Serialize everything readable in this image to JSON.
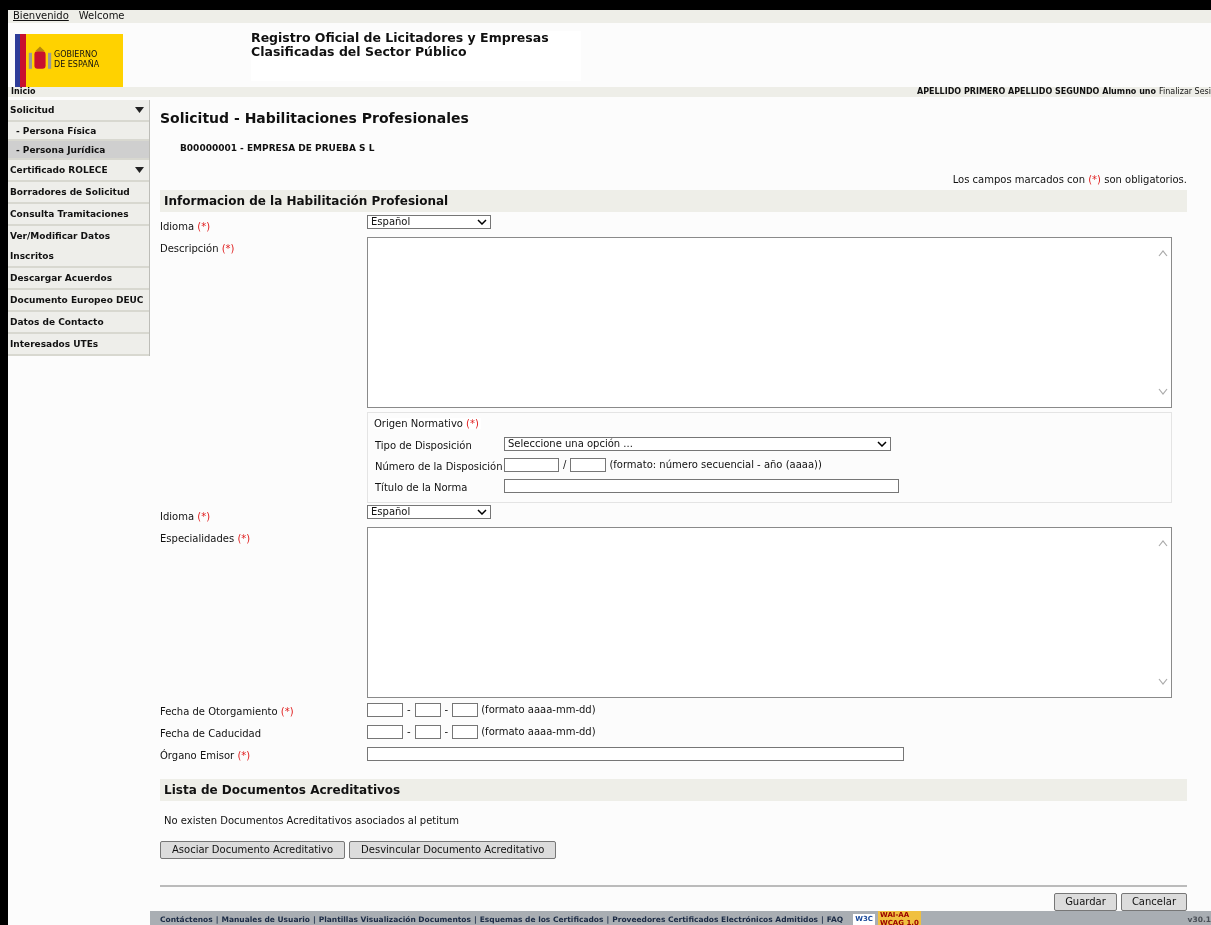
{
  "top_bar": [
    {
      "text": "Bienvenido",
      "kind": "link"
    },
    {
      "text": "Welcome",
      "kind": "plain"
    }
  ],
  "header": {
    "logo_lines": [
      "GOBIERNO",
      "DE ESPAÑA"
    ],
    "title_lines": [
      "Registro Oficial de Licitadores y Empresas",
      "Clasificadas del Sector Público"
    ]
  },
  "nav_bar": {
    "home": "Inicio",
    "user": "APELLIDO PRIMERO APELLIDO SEGUNDO Alumno uno",
    "logout": "Finalizar Sesi"
  },
  "sidebar": {
    "items": [
      {
        "label": "Solicitud",
        "kind": "group",
        "expanded": true,
        "selected": false,
        "children": [
          {
            "label": "- Persona Física",
            "selected": false
          },
          {
            "label": "- Persona Jurídica",
            "selected": true
          }
        ]
      },
      {
        "label": "Certificado ROLECE",
        "kind": "group",
        "selected": false
      },
      {
        "label": "Borradores de Solicitud",
        "selected": false
      },
      {
        "label": "Consulta Tramitaciones",
        "selected": false
      },
      {
        "label": "Ver/Modificar Datos Inscritos",
        "selected": false
      },
      {
        "label": "Descargar Acuerdos",
        "selected": false
      },
      {
        "label": "Documento Europeo DEUC",
        "selected": false
      },
      {
        "label": "Datos de Contacto",
        "selected": false
      },
      {
        "label": "Interesados UTEs",
        "selected": false
      }
    ]
  },
  "page": {
    "title": "Solicitud - Habilitaciones Profesionales",
    "company": "B00000001 - EMPRESA DE PRUEBA S L",
    "required_note": {
      "before": "Los campos marcados con",
      "mark": "(*)",
      "after": "son obligatorios."
    }
  },
  "section": {
    "title": "Informacion de la Habilitación Profesional",
    "fields": [
      {
        "kind": "select",
        "label": "Idioma",
        "mark": "(*)",
        "value": "Español"
      },
      {
        "kind": "textarea",
        "label": "Descripción",
        "mark": "(*)"
      },
      {
        "kind": "fieldset",
        "legend": "Origen Normativo",
        "mark": "(*)",
        "rows": [
          {
            "kind": "select",
            "label": "Tipo de Disposición",
            "value": "Seleccione una opción ..."
          },
          {
            "kind": "number",
            "label": "Número de la Disposición",
            "separator": "/",
            "hint": "(formato: número secuencial - año (aaaa))"
          },
          {
            "kind": "text",
            "label": "Título de la Norma"
          }
        ]
      },
      {
        "kind": "select",
        "label": "Idioma",
        "mark": "(*)",
        "value": "Español"
      },
      {
        "kind": "textarea",
        "label": "Especialidades",
        "mark": "(*)"
      },
      {
        "kind": "date",
        "label": "Fecha de Otorgamiento",
        "mark": "(*)",
        "separators": [
          "-",
          "-"
        ],
        "hint": "(formato aaaa-mm-dd)"
      },
      {
        "kind": "date",
        "label": "Fecha de Caducidad",
        "separators": [
          "-",
          "-"
        ],
        "hint": "(formato aaaa-mm-dd)"
      },
      {
        "kind": "text",
        "label": "Órgano Emisor",
        "mark": "(*)"
      }
    ]
  },
  "documents": {
    "title": "Lista de Documentos Acreditativos",
    "empty": "No existen Documentos Acreditativos asociados al petitum",
    "buttons": [
      "Asociar Documento Acreditativo",
      "Desvincular Documento Acreditativo"
    ]
  },
  "actions": [
    "Guardar",
    "Cancelar"
  ],
  "footer": {
    "links": [
      "Contáctenos",
      "Manuales de Usuario",
      "Plantillas Visualización Documentos",
      "Esquemas de los Certificados",
      "Proveedores Certificados Electrónicos Admitidos",
      "FAQ"
    ],
    "separator": "|",
    "badges": [
      "W3C",
      "WAI-AA",
      "WCAG 1.0"
    ],
    "version": "v30.1"
  }
}
